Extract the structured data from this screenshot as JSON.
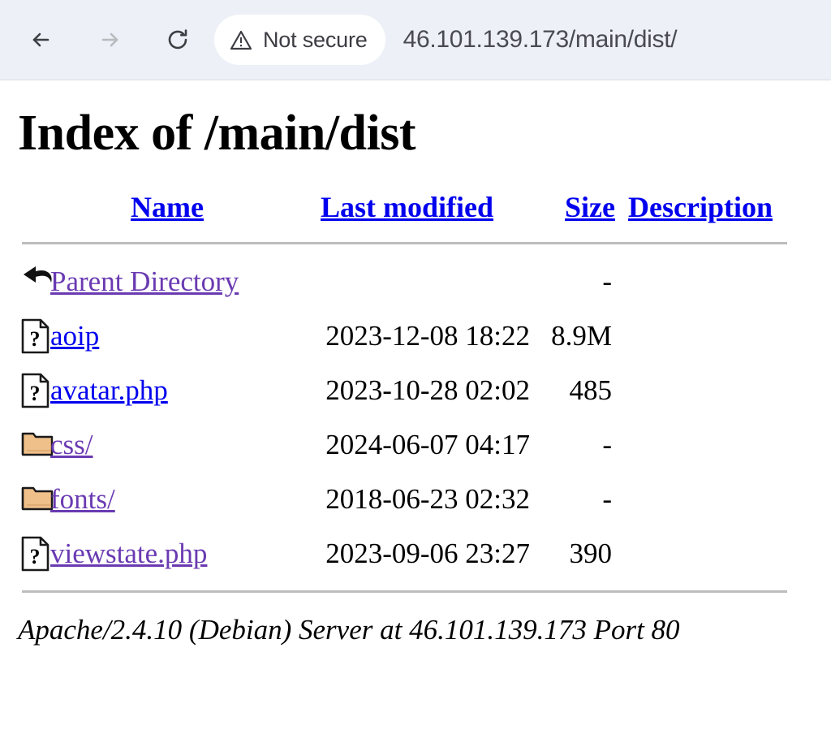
{
  "browser": {
    "back_label": "Back",
    "forward_label": "Forward",
    "reload_label": "Reload",
    "security_label": "Not secure",
    "url": "46.101.139.173/main/dist/",
    "toolbar_bg": "#eef0f8",
    "url_text_color": "#4a4a52"
  },
  "page": {
    "title": "Index of /main/dist",
    "link_color": "#0000ee",
    "visited_link_color": "#6a3ab2",
    "footer": "Apache/2.4.10 (Debian) Server at 46.101.139.173 Port 80"
  },
  "table": {
    "headers": {
      "name": "Name",
      "last_modified": "Last modified",
      "size": "Size",
      "description": "Description"
    },
    "rows": [
      {
        "icon": "parent-directory-icon",
        "name": "Parent Directory",
        "last_modified": "",
        "size": "-",
        "description": "",
        "visited": true
      },
      {
        "icon": "unknown-file-icon",
        "name": "aoip",
        "last_modified": "2023-12-08 18:22",
        "size": "8.9M",
        "description": "",
        "visited": false
      },
      {
        "icon": "unknown-file-icon",
        "name": "avatar.php",
        "last_modified": "2023-10-28 02:02",
        "size": "485",
        "description": "",
        "visited": false
      },
      {
        "icon": "folder-icon",
        "name": "css/",
        "last_modified": "2024-06-07 04:17",
        "size": "-",
        "description": "",
        "visited": true
      },
      {
        "icon": "folder-icon",
        "name": "fonts/",
        "last_modified": "2018-06-23 02:32",
        "size": "-",
        "description": "",
        "visited": true
      },
      {
        "icon": "unknown-file-icon",
        "name": "viewstate.php",
        "last_modified": "2023-09-06 23:27",
        "size": "390",
        "description": "",
        "visited": true
      }
    ]
  }
}
